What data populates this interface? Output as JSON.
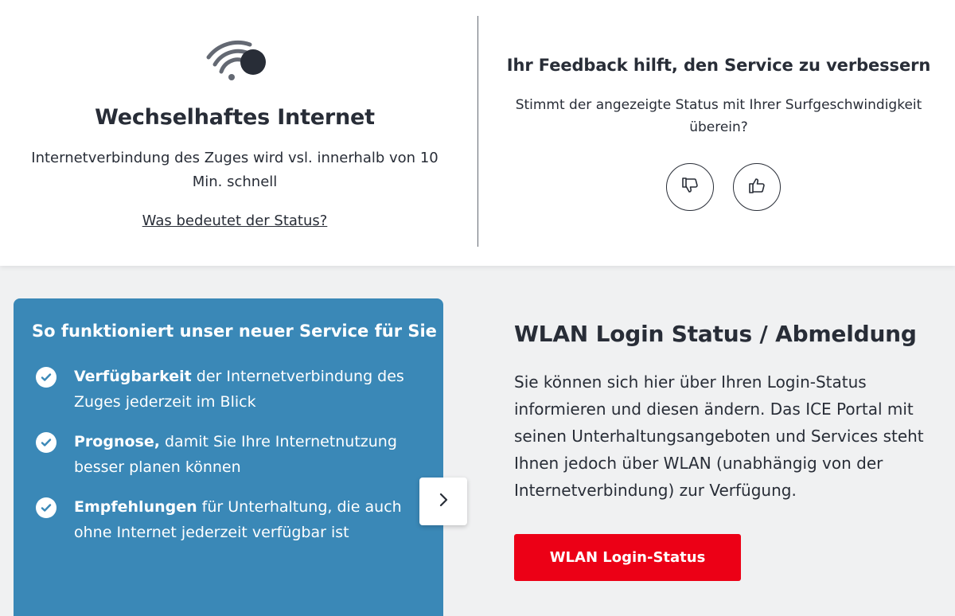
{
  "status": {
    "icon": "wifi-unstable-icon",
    "title": "Wechselhaftes Internet",
    "description": "Internetverbindung des Zuges wird vsl. innerhalb von 10 Min. schnell",
    "link_label": "Was bedeutet der Status?"
  },
  "feedback": {
    "title": "Ihr Feedback hilft, den Service zu verbessern",
    "question": "Stimmt der angezeigte Status mit Ihrer Surfgeschwindigkeit überein?",
    "thumbs_down_icon": "thumbs-down-icon",
    "thumbs_up_icon": "thumbs-up-icon"
  },
  "service": {
    "title": "So funktioniert unser neuer Service für Sie",
    "items": [
      {
        "bold": "Verfügbarkeit",
        "text": " der Internetverbindung des Zuges jederzeit im Blick"
      },
      {
        "bold": "Prognose,",
        "text": " damit Sie Ihre Internetnutzung besser planen können"
      },
      {
        "bold": "Empfehlungen",
        "text": " für Unterhaltung, die auch ohne Internet jederzeit verfügbar ist"
      }
    ],
    "next_icon": "chevron-right-icon"
  },
  "wlan": {
    "title": "WLAN Login Status / Abmeldung",
    "text": "Sie können sich hier über Ihren Login-Status informieren und diesen ändern. Das ICE Portal mit seinen Unterhaltungsangeboten und Services steht Ihnen jedoch über WLAN (unabhängig von der Internetverbindung) zur Verfügung.",
    "button_label": "WLAN Login-Status"
  },
  "colors": {
    "service_blue": "#3a88b7",
    "button_red": "#ec0016",
    "text_dark": "#282d37"
  }
}
